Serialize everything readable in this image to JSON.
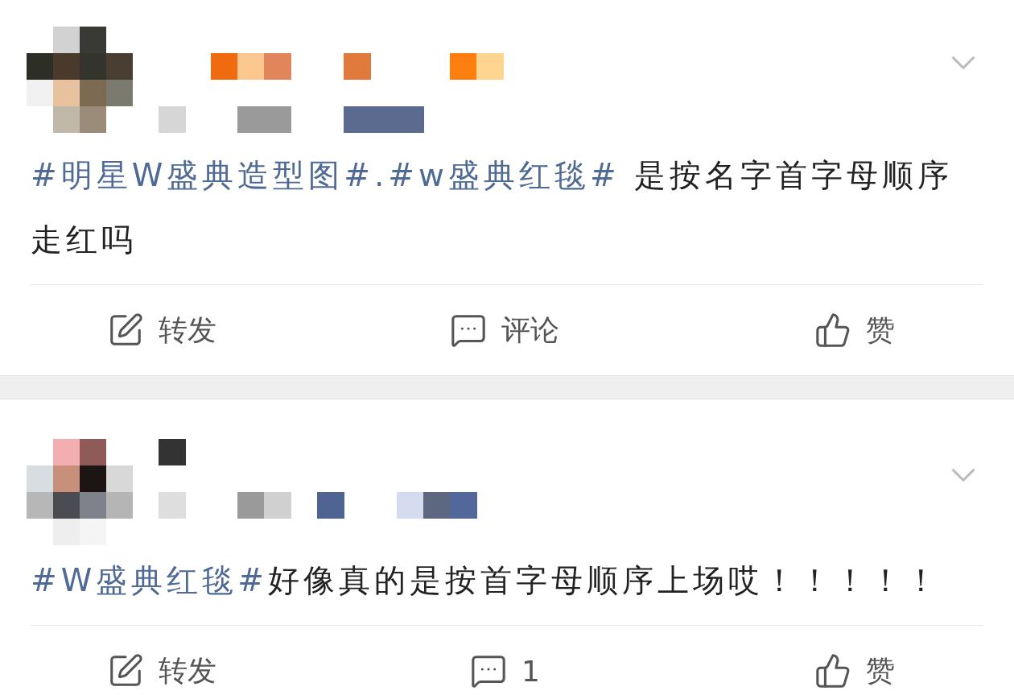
{
  "posts": [
    {
      "text": [
        {
          "kind": "hashtag",
          "text": "#明星W盛典造型图#.#w盛典红毯#"
        },
        {
          "kind": "plain",
          "text": " 是按名字首字母顺序走红吗"
        }
      ],
      "actions": [
        {
          "kind": "repost",
          "label": "转发"
        },
        {
          "kind": "comment",
          "label": "评论"
        },
        {
          "kind": "like",
          "label": "赞"
        }
      ]
    },
    {
      "text": [
        {
          "kind": "hashtag",
          "text": "#W盛典红毯#"
        },
        {
          "kind": "plain",
          "text": "好像真的是按首字母顺序上场哎！！！！！"
        }
      ],
      "actions": [
        {
          "kind": "repost",
          "label": "转发"
        },
        {
          "kind": "comment",
          "label": "1"
        },
        {
          "kind": "like",
          "label": "赞"
        }
      ]
    }
  ]
}
